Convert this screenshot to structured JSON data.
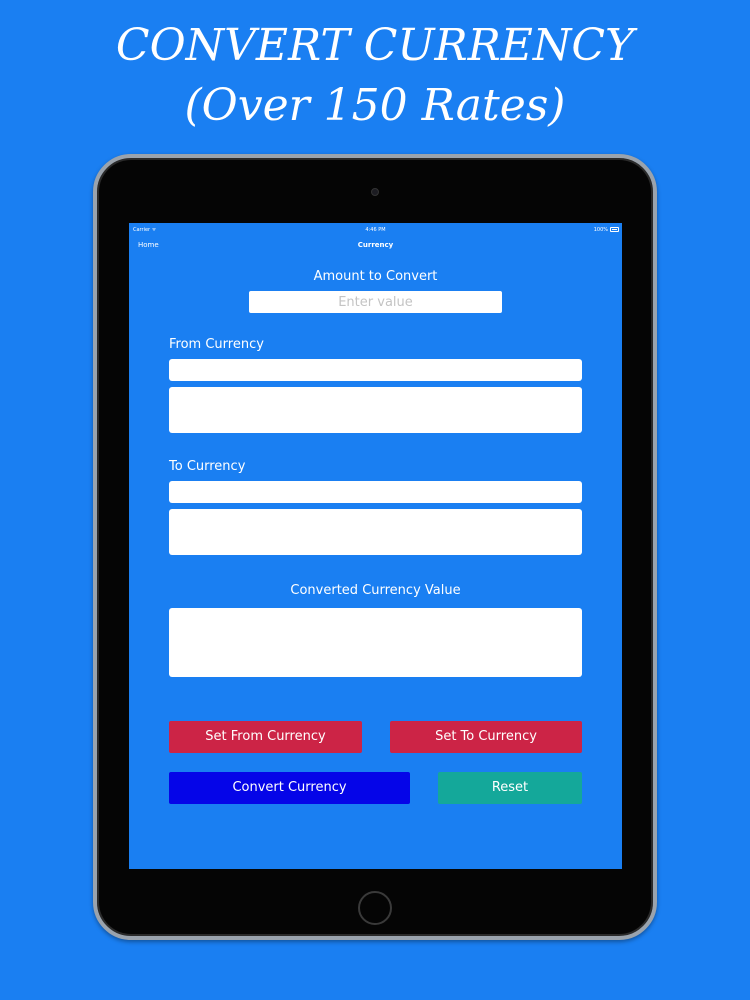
{
  "promo": {
    "line1": "CONVERT CURRENCY",
    "line2": "(Over 150 Rates)"
  },
  "statusbar": {
    "carrier": "Carrier ᯤ",
    "time": "4:46 PM",
    "battery": "100%"
  },
  "navbar": {
    "back": "Home",
    "title": "Currency"
  },
  "form": {
    "amount_label": "Amount to Convert",
    "amount_placeholder": "Enter value",
    "amount_value": "",
    "from_label": "From Currency",
    "from_value": "",
    "from_detail": "",
    "to_label": "To Currency",
    "to_value": "",
    "to_detail": "",
    "result_label": "Converted Currency Value",
    "result_value": ""
  },
  "buttons": {
    "set_from": "Set From Currency",
    "set_to": "Set To Currency",
    "convert": "Convert Currency",
    "reset": "Reset"
  },
  "colors": {
    "background": "#1a7ff2",
    "red_button": "#cc2446",
    "blue_button": "#0505e8",
    "teal_button": "#14a89a"
  }
}
